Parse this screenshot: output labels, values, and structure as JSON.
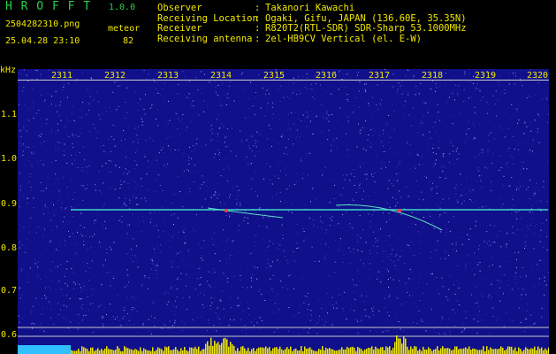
{
  "header": {
    "app_name": "H R O F F T",
    "version": "1.0.0",
    "filename": "2504282310.png",
    "datetime": "25.04.28 23:10",
    "mode": "meteor",
    "count": "82"
  },
  "info": [
    {
      "label": "Observer",
      "value": "Takanori Kawachi"
    },
    {
      "label": "Receiving Location",
      "value": "Ogaki, Gifu, JAPAN (136.60E, 35.35N)"
    },
    {
      "label": "Receiver",
      "value": "R820T2(RTL-SDR) SDR-Sharp 53.1000MHz"
    },
    {
      "label": "Receiving antenna",
      "value": "2el-HB9CV Vertical (el. E-W)"
    }
  ],
  "axes": {
    "y_unit": "kHz",
    "y_ticks": [
      "1.1",
      "1.0",
      "0.9",
      "0.8",
      "0.7",
      "0.6"
    ],
    "x_ticks": [
      "2311",
      "2312",
      "2313",
      "2314",
      "2315",
      "2316",
      "2317",
      "2318",
      "2319",
      "2320"
    ]
  },
  "colors": {
    "background": "#000000",
    "plot_bg": "#10108a",
    "label_yellow": "#f0e800",
    "title_green": "#27d14a",
    "signal_line": "#3cd6c8",
    "meteor_red": "#ff3b3b",
    "level_bars": "#f0e800"
  }
}
